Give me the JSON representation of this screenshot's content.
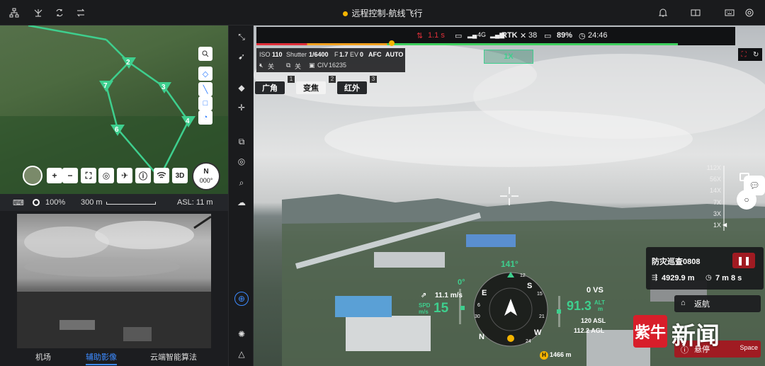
{
  "header": {
    "title": "远程控制-航线飞行",
    "status_color": "#f5b400",
    "left_icons": [
      "topology-icon",
      "antenna-icon",
      "sync-icon",
      "switch-icon"
    ],
    "right_icons": [
      "bell-icon",
      "layout-icon",
      "keyboard-icon",
      "settings-icon"
    ]
  },
  "map": {
    "waypoints": [
      "2",
      "3",
      "7",
      "6",
      "4"
    ],
    "route_color": "#3ecf8e",
    "zoom_pct": "100%",
    "scale": "300 m",
    "asl": "ASL: 11 m",
    "controls": [
      "+",
      "−"
    ],
    "view_3d": "3D",
    "compass_letter": "N",
    "compass_value": "000°"
  },
  "left_nav": {
    "tabs": [
      "机场",
      "辅助影像",
      "云端智能算法"
    ],
    "active": "辅助影像"
  },
  "status_bar": {
    "delay": "1.1 s",
    "signal": "4G",
    "rtk_label": "RTK",
    "rtk_count": "38",
    "battery": "89%",
    "flight_time": "24:46",
    "progress_pct": 88
  },
  "camera_params": {
    "iso_label": "ISO",
    "iso": "110",
    "shutter_label": "Shutter",
    "shutter": "1/6400",
    "f_label": "F",
    "f": "1.7",
    "ev_label": "EV",
    "ev": "0",
    "afc": "AFC",
    "auto": "AUTO",
    "mode1": "关",
    "mode2": "关",
    "civ_label": "CIV",
    "civ": "16235"
  },
  "lens": {
    "buttons": [
      {
        "label": "广角",
        "num": "1"
      },
      {
        "label": "变焦",
        "num": "2"
      },
      {
        "label": "红外",
        "num": "3"
      }
    ],
    "active": "变焦"
  },
  "zoom": {
    "current": "1X",
    "scale": [
      "112X",
      "56X",
      "14X",
      "7X",
      "3X",
      "1X"
    ]
  },
  "hud": {
    "heading": "141°",
    "gimbal_pitch": "0°",
    "wind": "11.1 m/s",
    "spd_label": "SPD",
    "spd_unit": "m/s",
    "speed": "15",
    "vs": "0 VS",
    "alt": "91.3",
    "alt_label": "ALT",
    "alt_unit": "m",
    "asl": "120 ASL",
    "agl": "112.2 AGL",
    "home_dist": "1466 m",
    "compass_marks": [
      "S",
      "E",
      "N",
      "W"
    ],
    "ticks": [
      "12",
      "15",
      "21",
      "24",
      "30",
      "6"
    ]
  },
  "mission": {
    "name": "防灾巡查0808",
    "distance": "4929.9 m",
    "eta": "7 m 8 s",
    "pause_icon": "pause-icon"
  },
  "actions": {
    "return_home": "返航",
    "hover": "悬停",
    "hover_key": "Space"
  },
  "watermark": {
    "logo": "紫牛",
    "text": "新闻"
  }
}
